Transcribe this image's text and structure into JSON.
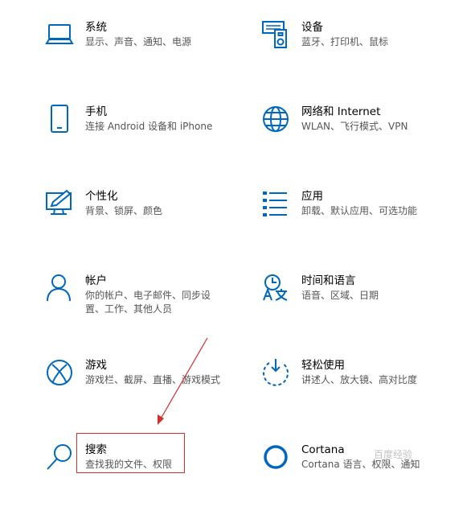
{
  "accent_color": "#0067c0",
  "annotation_color": "#d22f2f",
  "tiles": [
    {
      "title": "系统",
      "desc": "显示、声音、通知、电源",
      "icon": "laptop-icon"
    },
    {
      "title": "设备",
      "desc": "蓝牙、打印机、鼠标",
      "icon": "devices-icon"
    },
    {
      "title": "手机",
      "desc": "连接 Android 设备和 iPhone",
      "icon": "phone-icon"
    },
    {
      "title": "网络和 Internet",
      "desc": "WLAN、飞行模式、VPN",
      "icon": "globe-icon"
    },
    {
      "title": "个性化",
      "desc": "背景、锁屏、颜色",
      "icon": "personalization-icon"
    },
    {
      "title": "应用",
      "desc": "卸载、默认应用、可选功能",
      "icon": "apps-list-icon"
    },
    {
      "title": "帐户",
      "desc": "你的帐户、电子邮件、同步设置、工作、其他人员",
      "icon": "person-icon"
    },
    {
      "title": "时间和语言",
      "desc": "语音、区域、日期",
      "icon": "time-language-icon"
    },
    {
      "title": "游戏",
      "desc": "游戏栏、截屏、直播、游戏模式",
      "icon": "xbox-icon"
    },
    {
      "title": "轻松使用",
      "desc": "讲述人、放大镜、高对比度",
      "icon": "ease-of-access-icon"
    },
    {
      "title": "搜索",
      "desc": "查找我的文件、权限",
      "icon": "search-icon"
    },
    {
      "title": "Cortana",
      "desc": "Cortana 语言、权限、通知",
      "icon": "cortana-icon"
    }
  ],
  "watermark": "百度经验"
}
